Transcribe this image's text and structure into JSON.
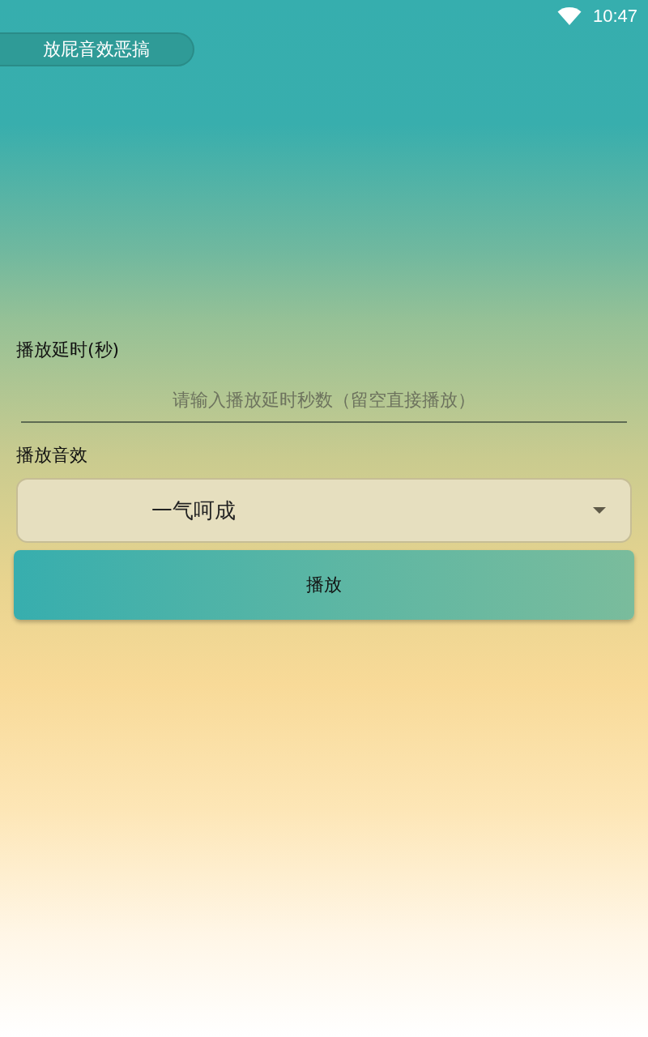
{
  "status_bar": {
    "time": "10:47"
  },
  "title_badge": {
    "label": "放屁音效恶搞"
  },
  "delay": {
    "label": "播放延时(秒)",
    "placeholder": "请输入播放延时秒数（留空直接播放）"
  },
  "sound": {
    "label": "播放音效",
    "value": "一气呵成"
  },
  "play_button": {
    "label": "播放"
  }
}
